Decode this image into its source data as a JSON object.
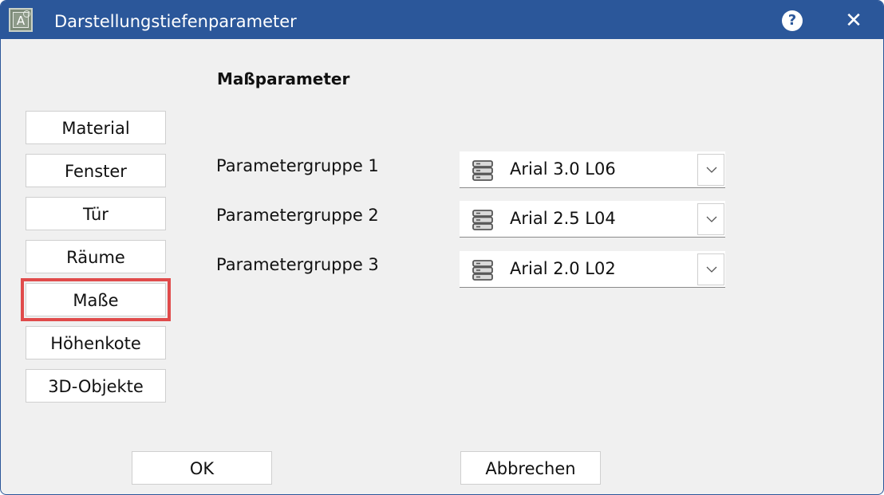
{
  "window": {
    "title": "Darstellungstiefenparameter",
    "app_icon": "A",
    "help": "?",
    "close": "✕"
  },
  "section": {
    "title": "Maßparameter"
  },
  "nav": {
    "items": [
      {
        "label": "Material"
      },
      {
        "label": "Fenster"
      },
      {
        "label": "Tür"
      },
      {
        "label": "Räume"
      },
      {
        "label": "Maße",
        "selected": true
      },
      {
        "label": "Höhenkote"
      },
      {
        "label": "3D-Objekte"
      }
    ]
  },
  "params": [
    {
      "label": "Parametergruppe 1",
      "value": "Arial 3.0 L06"
    },
    {
      "label": "Parametergruppe 2",
      "value": "Arial 2.5 L04"
    },
    {
      "label": "Parametergruppe 3",
      "value": "Arial 2.0 L02"
    }
  ],
  "buttons": {
    "ok": "OK",
    "cancel": "Abbrechen"
  },
  "colors": {
    "titlebar": "#2b579a",
    "selected_outline": "#e04b4b"
  },
  "icons": {
    "select": "database-icon",
    "dropdown": "chevron-down-icon"
  }
}
